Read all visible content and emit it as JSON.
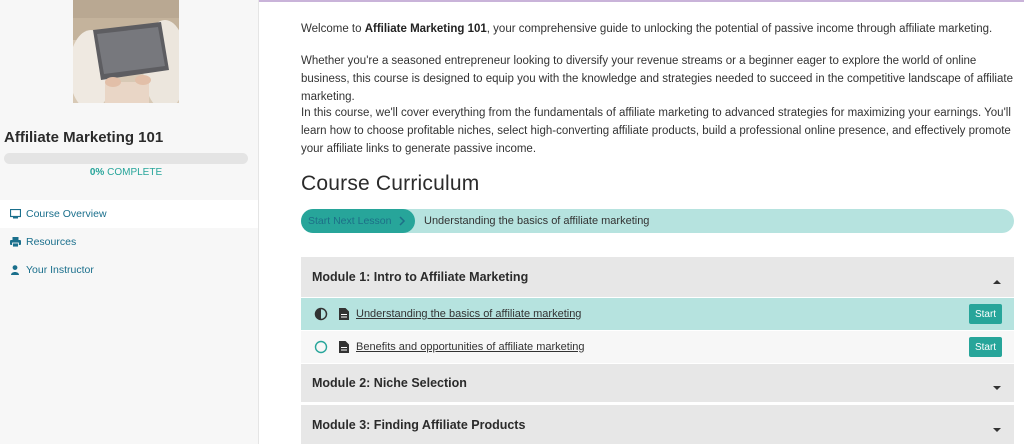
{
  "course": {
    "title": "Affiliate Marketing 101",
    "progress_percent": 0,
    "progress_value": "0%",
    "progress_suffix": "COMPLETE"
  },
  "sidebar": {
    "items": [
      {
        "label": "Course Overview",
        "icon": "monitor-icon"
      },
      {
        "label": "Resources",
        "icon": "printer-icon"
      },
      {
        "label": "Your Instructor",
        "icon": "user-icon"
      }
    ]
  },
  "intro": {
    "p1_before": "Welcome to ",
    "p1_bold": "Affiliate Marketing 101",
    "p1_after": ", your comprehensive guide to unlocking the potential of passive income through affiliate marketing.",
    "p2": "Whether you're a seasoned entrepreneur looking to diversify your revenue streams or a beginner eager to explore the world of online business, this course is designed to equip you with the knowledge and strategies needed to succeed in the competitive landscape of affiliate marketing.",
    "p3": "In this course, we'll cover everything from the fundamentals of affiliate marketing to advanced strategies for maximizing your earnings. You'll learn how to choose profitable niches, select high-converting affiliate products, build a professional online presence, and effectively promote your affiliate links to generate passive income."
  },
  "curriculum": {
    "title": "Course Curriculum",
    "next_button": "Start Next Lesson",
    "next_lesson": "Understanding the basics of affiliate marketing",
    "modules": [
      {
        "title": "Module 1: Intro to Affiliate Marketing",
        "expanded": true,
        "lessons": [
          {
            "title": "Understanding the basics of affiliate marketing",
            "status": "in-progress",
            "button": "Start"
          },
          {
            "title": "Benefits and opportunities of affiliate marketing",
            "status": "not-started",
            "button": "Start"
          }
        ]
      },
      {
        "title": "Module 2: Niche Selection",
        "expanded": false
      },
      {
        "title": "Module 3: Finding Affiliate Products",
        "expanded": false
      }
    ]
  },
  "colors": {
    "accent": "#27a59a",
    "accent_light": "#b6e3df",
    "link": "#1a6f8c",
    "module_bg": "#e7e7e7"
  }
}
